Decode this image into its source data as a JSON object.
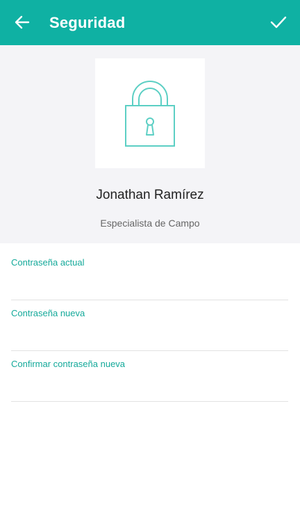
{
  "app_bar": {
    "title": "Seguridad",
    "back_icon": "arrow-left-icon",
    "confirm_icon": "check-icon",
    "background_color": "#0fb1a3"
  },
  "profile": {
    "lock_icon": "lock-icon",
    "name": "Jonathan Ramírez",
    "role": "Especialista de Campo",
    "background_color": "#f4f4f7"
  },
  "form": {
    "fields": [
      {
        "label": "Contraseña actual",
        "value": ""
      },
      {
        "label": "Contraseña nueva",
        "value": ""
      },
      {
        "label": "Confirmar contraseña nueva",
        "value": ""
      }
    ],
    "label_color": "#14a99a"
  }
}
